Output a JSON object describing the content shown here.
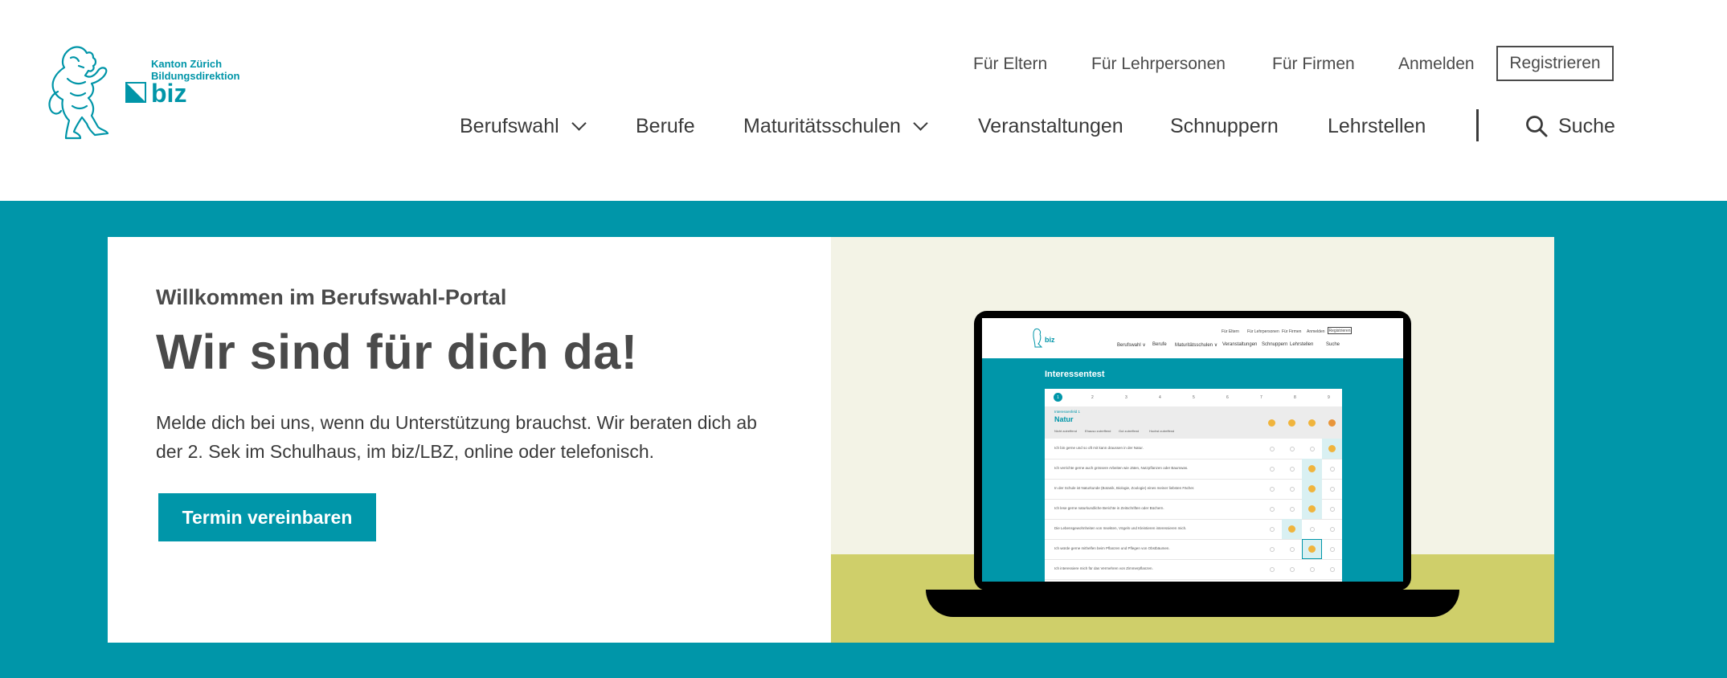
{
  "brand": {
    "line1": "Kanton Zürich",
    "line2": "Bildungsdirektion",
    "word": "biz",
    "color": "#0095a8"
  },
  "meta_nav": [
    {
      "label": "Für Eltern"
    },
    {
      "label": "Für Lehrpersonen"
    },
    {
      "label": "Für Firmen"
    },
    {
      "label": "Anmelden"
    }
  ],
  "register_label": "Registrieren",
  "main_nav": [
    {
      "label": "Berufswahl",
      "dropdown": true
    },
    {
      "label": "Berufe",
      "dropdown": false
    },
    {
      "label": "Maturitätsschulen",
      "dropdown": true
    },
    {
      "label": "Veranstaltungen",
      "dropdown": false
    },
    {
      "label": "Schnuppern",
      "dropdown": false
    },
    {
      "label": "Lehrstellen",
      "dropdown": false
    }
  ],
  "search_label": "Suche",
  "hero": {
    "eyebrow": "Willkommen im Berufswahl-Portal",
    "title": "Wir sind für dich da!",
    "text": "Melde dich bei uns, wenn du Unterstützung brauchst. Wir beraten dich ab der 2. Sek im Schulhaus, im biz/LBZ, online oder telefonisch.",
    "cta": "Termin vereinbaren",
    "accent": "#0096a9"
  },
  "laptop_screen": {
    "meta_nav": [
      "Für Eltern",
      "Für Lehrpersonen",
      "Für Firmen",
      "Anmelden"
    ],
    "register": "Registrieren",
    "main_nav": [
      "Berufswahl ∨",
      "Berufe",
      "Maturitätsschulen ∨",
      "Veranstaltungen",
      "Schnuppern",
      "Lehrstellen"
    ],
    "search": "Suche",
    "title": "Interessentest",
    "steps": [
      "1",
      "2",
      "3",
      "4",
      "5",
      "6",
      "7",
      "8",
      "9"
    ],
    "section_label": "Interessenfeld 1",
    "section_title": "Natur",
    "legend": [
      "Nicht zutreffend",
      "Ehauso zutreffend",
      "Gut zutreffend",
      "Hochst zutreffend"
    ],
    "rows": [
      "Ich bin gerne und so oft mit kann draussen in der Natur.",
      "Ich verrichte gerne auch grössere Arbeiten wie Jäten, Nutzpflanzen oder Baumwas.",
      "In der Schule ist Naturkunde (Botanik, Biologie, Zoologie) eines meiner liebsten Fächer.",
      "Ich lese gerne naturkundliche Berichte in Zeitschriften oder Büchern.",
      "Die Lebensgewohnheiten von Insekten, Vögeln und Kleintieren interessieren mich.",
      "Ich würde gerne mithelfen beim Pflanzen und Pflegen von Obstbäumen.",
      "Ich interessiere mich für das Vermehren von Zimmerpflanzen."
    ]
  }
}
